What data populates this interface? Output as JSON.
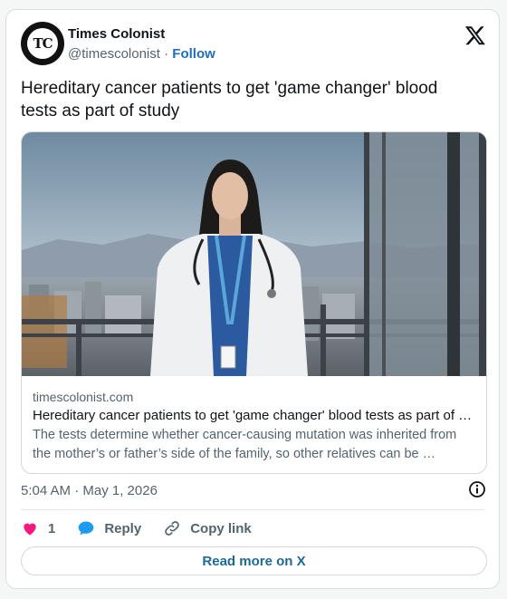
{
  "account": {
    "name": "Times Colonist",
    "handle": "@timescolonist",
    "separator": "·",
    "follow_label": "Follow",
    "avatar_initials": "TC"
  },
  "post": {
    "text": "Hereditary cancer patients to get 'game changer' blood tests as part of study",
    "timestamp": "5:04 AM · May 1, 2026"
  },
  "link_card": {
    "domain": "timescolonist.com",
    "title": "Hereditary cancer patients to get 'game changer' blood tests as part of study",
    "description": "The tests determine whether cancer-causing mutation was inherited from the mother’s or father’s side of the family, so other relatives can be …",
    "image_description": "Doctor in white coat with stethoscope standing on balcony overlooking city and mountains"
  },
  "actions": {
    "like_count": "1",
    "reply_label": "Reply",
    "copy_label": "Copy link",
    "read_more_label": "Read more on X"
  },
  "colors": {
    "like": "#f91880",
    "reply": "#1d9bf0",
    "link": "#1d6fb8"
  },
  "icons": [
    "x-logo-icon",
    "info-icon",
    "heart-icon",
    "reply-bubble-icon",
    "link-icon"
  ]
}
